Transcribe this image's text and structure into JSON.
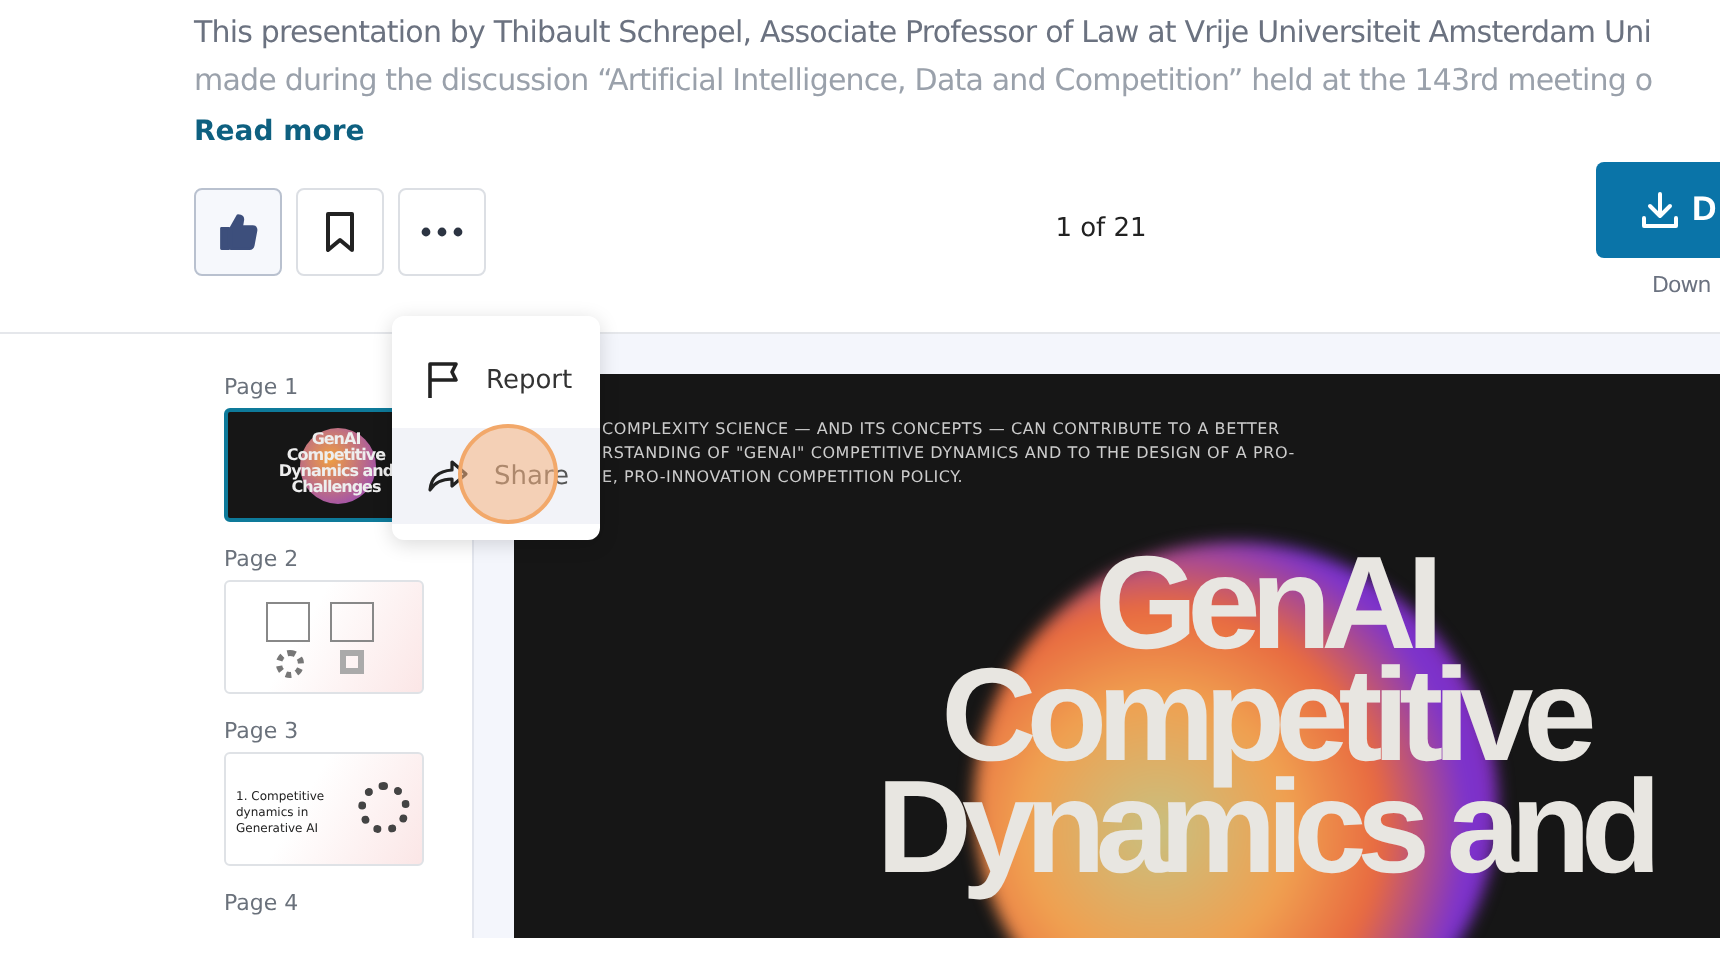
{
  "description": {
    "lines": [
      "This presentation by Thibault Schrepel, Associate Professor of Law at Vrije Universiteit Amsterdam Uni",
      "made during the discussion “Artificial Intelligence, Data and Competition” held at the 143rd meeting o"
    ],
    "read_more": "Read more"
  },
  "actions": [
    {
      "kind": "like",
      "on": true
    },
    {
      "kind": "bookmark",
      "on": false
    },
    {
      "kind": "more"
    }
  ],
  "page_counter": "1 of 21",
  "download": {
    "label": "D",
    "caption": "Down"
  },
  "menu": [
    {
      "kind": "report",
      "label": "Report",
      "selected": false
    },
    {
      "kind": "share",
      "label": "Share",
      "selected": true
    }
  ],
  "pages": [
    {
      "label": "Page 1",
      "selected": true,
      "kind": "title",
      "thumb_text": "GenAI Competitive Dynamics and Challenges"
    },
    {
      "label": "Page 2",
      "selected": false,
      "kind": "boxes"
    },
    {
      "label": "Page 3",
      "selected": false,
      "kind": "section",
      "thumb_text": "1. Competitive dynamics in Generative AI"
    },
    {
      "label": "Page 4",
      "selected": false,
      "kind": "none"
    }
  ],
  "slide": {
    "intro": [
      "COMPLEXITY SCIENCE — AND ITS CONCEPTS — CAN CONTRIBUTE TO A BETTER",
      "RSTANDING OF \"GENAI\" COMPETITIVE DYNAMICS AND TO THE DESIGN OF A PRO-",
      "E, PRO-INNOVATION COMPETITION POLICY."
    ],
    "title": [
      "GenAI",
      "Competitive",
      "Dynamics and"
    ]
  }
}
